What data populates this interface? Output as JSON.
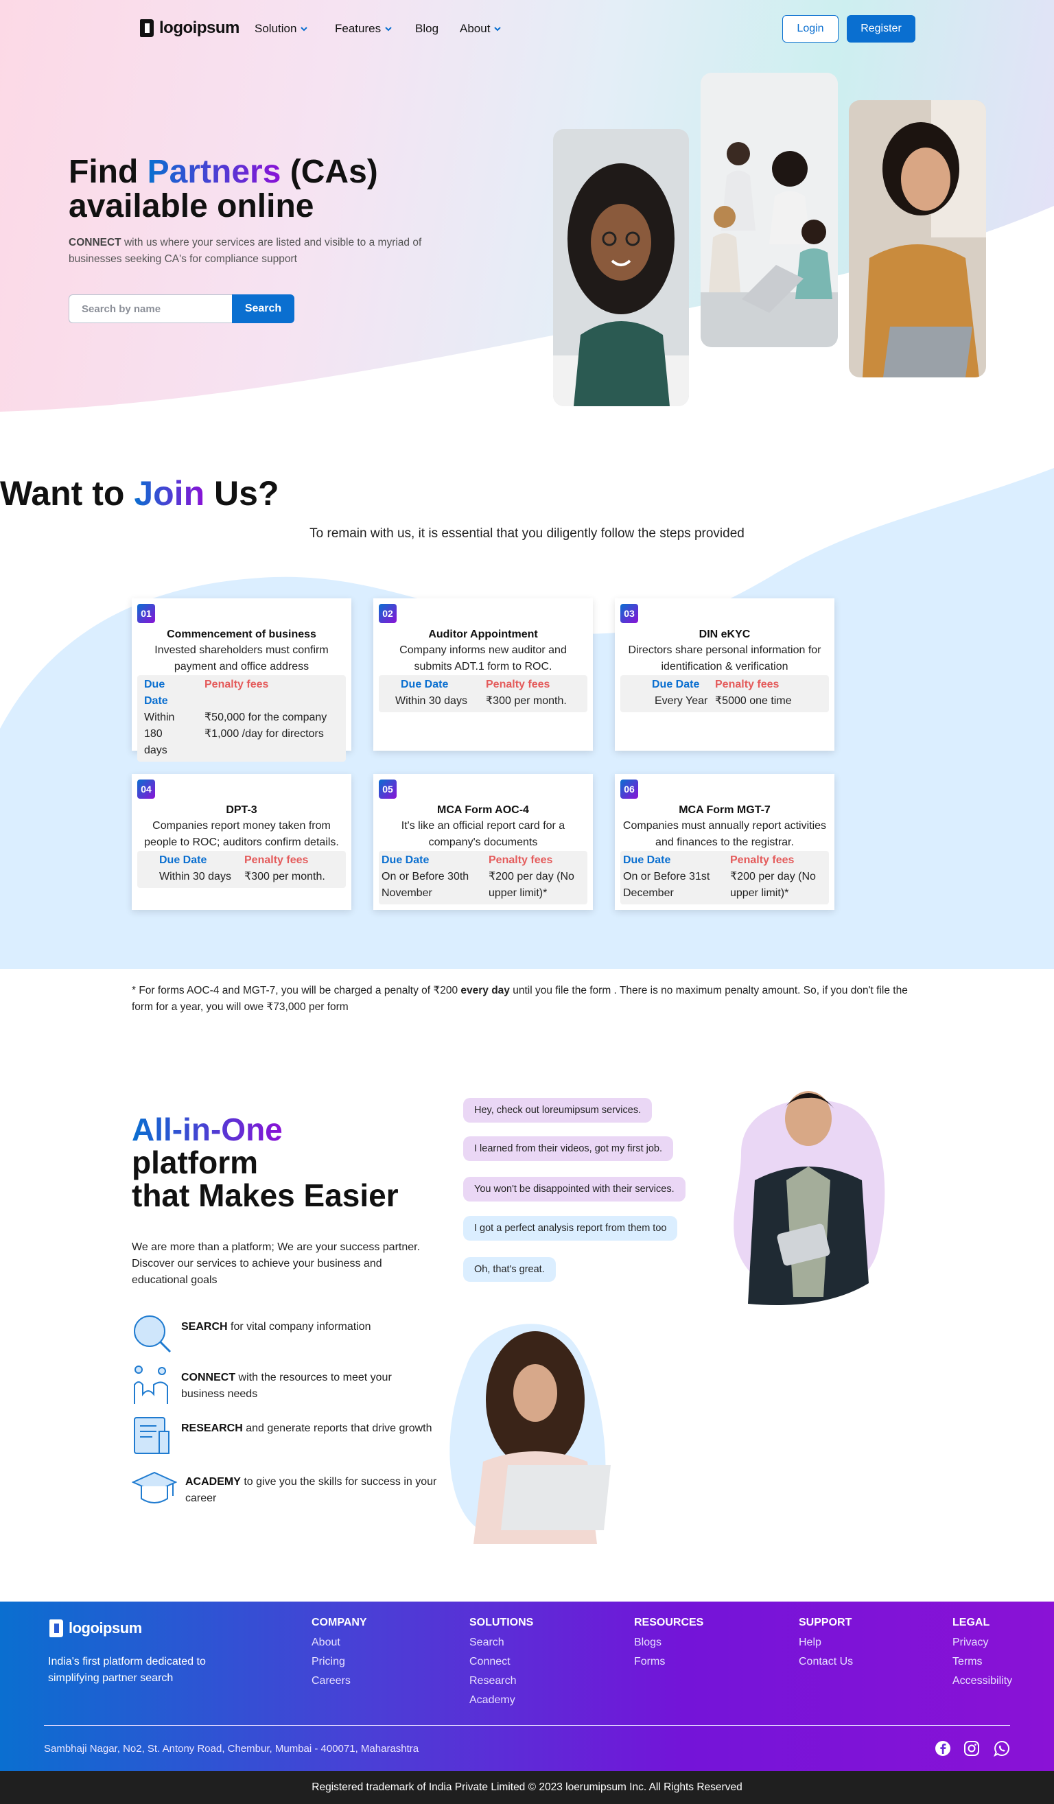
{
  "nav": {
    "logo": "logoipsum",
    "items": [
      {
        "label": "Solution",
        "has_dropdown": true
      },
      {
        "label": "Features",
        "has_dropdown": true
      },
      {
        "label": "Blog",
        "has_dropdown": false
      },
      {
        "label": "About",
        "has_dropdown": true
      }
    ],
    "login": "Login",
    "register": "Register"
  },
  "hero": {
    "title_find": "Find",
    "title_partners": "Partners",
    "title_cas": "(CAs)",
    "title_line2": "available online",
    "subtitle_strong": "CONNECT",
    "subtitle_rest": " with us where your services are listed and visible to a myriad of businesses seeking CA's for compliance support",
    "search_placeholder": "Search by name",
    "search_value": "",
    "search_button": "Search"
  },
  "join": {
    "title_want": "Want to",
    "title_join": "Join",
    "title_us": "Us?",
    "subtitle": "To remain with us, it is essential that you diligently follow the steps provided",
    "due_header": "Due Date",
    "penalty_header": "Penalty fees",
    "cards": [
      {
        "num": "01",
        "title": "Commencement of business",
        "desc": "Invested shareholders must confirm payment and office address",
        "due": "Within 180 days",
        "penalty": "₹50,000 for the company ₹1,000 /day for directors"
      },
      {
        "num": "02",
        "title": "Auditor Appointment",
        "desc": "Company informs new auditor and submits ADT.1 form to ROC.",
        "due": "Within 30 days",
        "penalty": "₹300 per month."
      },
      {
        "num": "03",
        "title": "DIN eKYC",
        "desc": "Directors share personal information for identification & verification",
        "due": "Every Year",
        "penalty": "₹5000 one time"
      },
      {
        "num": "04",
        "title": "DPT-3",
        "desc": "Companies report money taken from people to ROC; auditors confirm details.",
        "due": "Within 30 days",
        "penalty": "₹300 per month."
      },
      {
        "num": "05",
        "title": "MCA Form AOC-4",
        "desc": "It's like an official report card for a company's documents",
        "due": "On or Before 30th November",
        "penalty": "₹200 per day (No upper limit)*"
      },
      {
        "num": "06",
        "title": "MCA Form MGT-7",
        "desc": "Companies must annually report activities and finances to the registrar.",
        "due": "On or Before 31st December",
        "penalty": "₹200 per day (No upper limit)*"
      }
    ],
    "footnote_a": "* For forms AOC-4 and MGT-7, you will be charged a penalty of ₹200 ",
    "footnote_b": "every day",
    "footnote_c": " until you file the form . There is no maximum penalty amount. So, if you don't file the form for a year, you will owe ₹73,000 per form"
  },
  "aio": {
    "title_grad": "All-in-One",
    "title_line2": "platform",
    "title_line3": "that Makes Easier",
    "subtitle": "We are more than a platform; We are your success partner. Discover our services to achieve your business and educational goals",
    "features": [
      {
        "strong": "SEARCH",
        "rest": " for vital company information",
        "icon": "magnifier-icon"
      },
      {
        "strong": "CONNECT",
        "rest": " with the resources to meet your business needs",
        "icon": "people-connect-icon"
      },
      {
        "strong": "RESEARCH",
        "rest": " and generate reports that drive growth",
        "icon": "document-icon"
      },
      {
        "strong": "ACADEMY",
        "rest": " to give you the skills for success in your career",
        "icon": "graduation-cap-icon"
      }
    ],
    "bubbles": [
      "Hey, check out loreumipsum services.",
      "I learned from their videos, got my first job.",
      "You won't be disappointed with their services.",
      "I got a perfect analysis report from them too",
      "Oh, that's great."
    ]
  },
  "footer": {
    "logo": "logoipsum",
    "tagline": "India's first platform dedicated to simplifying partner search",
    "columns": [
      {
        "title": "COMPANY",
        "links": [
          "About",
          "Pricing",
          "Careers"
        ]
      },
      {
        "title": "SOLUTIONS",
        "links": [
          "Search",
          "Connect",
          "Research",
          "Academy"
        ]
      },
      {
        "title": "RESOURCES",
        "links": [
          "Blogs",
          "Forms"
        ]
      },
      {
        "title": "SUPPORT",
        "links": [
          "Help",
          "Contact Us"
        ]
      },
      {
        "title": "LEGAL",
        "links": [
          "Privacy",
          "Terms",
          "Accessibility"
        ]
      }
    ],
    "address": "Sambhaji Nagar, No2, St. Antony Road, Chembur, Mumbai - 400071, Maharashtra",
    "social": [
      "facebook-icon",
      "instagram-icon",
      "whatsapp-icon"
    ],
    "copyright": "Registered trademark of India Private Limited © 2023 loerumipsum Inc. All Rights Reserved"
  },
  "colors": {
    "primary": "#0a6fd0",
    "purple": "#8a12d6",
    "penalty": "#e45b5b",
    "light_blue": "#dbeeff"
  }
}
